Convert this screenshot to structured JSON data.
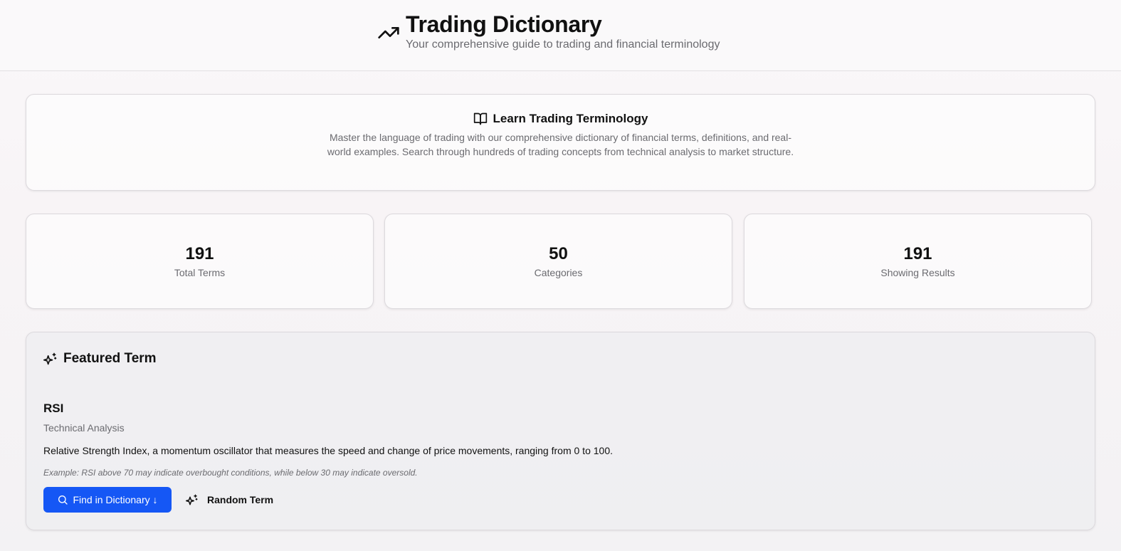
{
  "header": {
    "title": "Trading Dictionary",
    "subtitle": "Your comprehensive guide to trading and financial terminology",
    "icon": "trending-up-icon"
  },
  "intro": {
    "icon": "book-open-icon",
    "title": "Learn Trading Terminology",
    "text": "Master the language of trading with our comprehensive dictionary of financial terms, definitions, and real-world examples. Search through hundreds of trading concepts from technical analysis to market structure."
  },
  "stats": [
    {
      "value": "191",
      "label": "Total Terms"
    },
    {
      "value": "50",
      "label": "Categories"
    },
    {
      "value": "191",
      "label": "Showing Results"
    }
  ],
  "featured": {
    "icon": "sparkles-icon",
    "heading": "Featured Term",
    "term": "RSI",
    "category": "Technical Analysis",
    "definition": "Relative Strength Index, a momentum oscillator that measures the speed and change of price movements, ranging from 0 to 100.",
    "example": "Example: RSI above 70 may indicate overbought conditions, while below 30 may indicate oversold.",
    "find_button": "Find in Dictionary ↓",
    "random_button": "Random Term"
  },
  "colors": {
    "accent": "#1557f5",
    "muted_text": "#6b6b70",
    "border": "#dcd9dd"
  }
}
